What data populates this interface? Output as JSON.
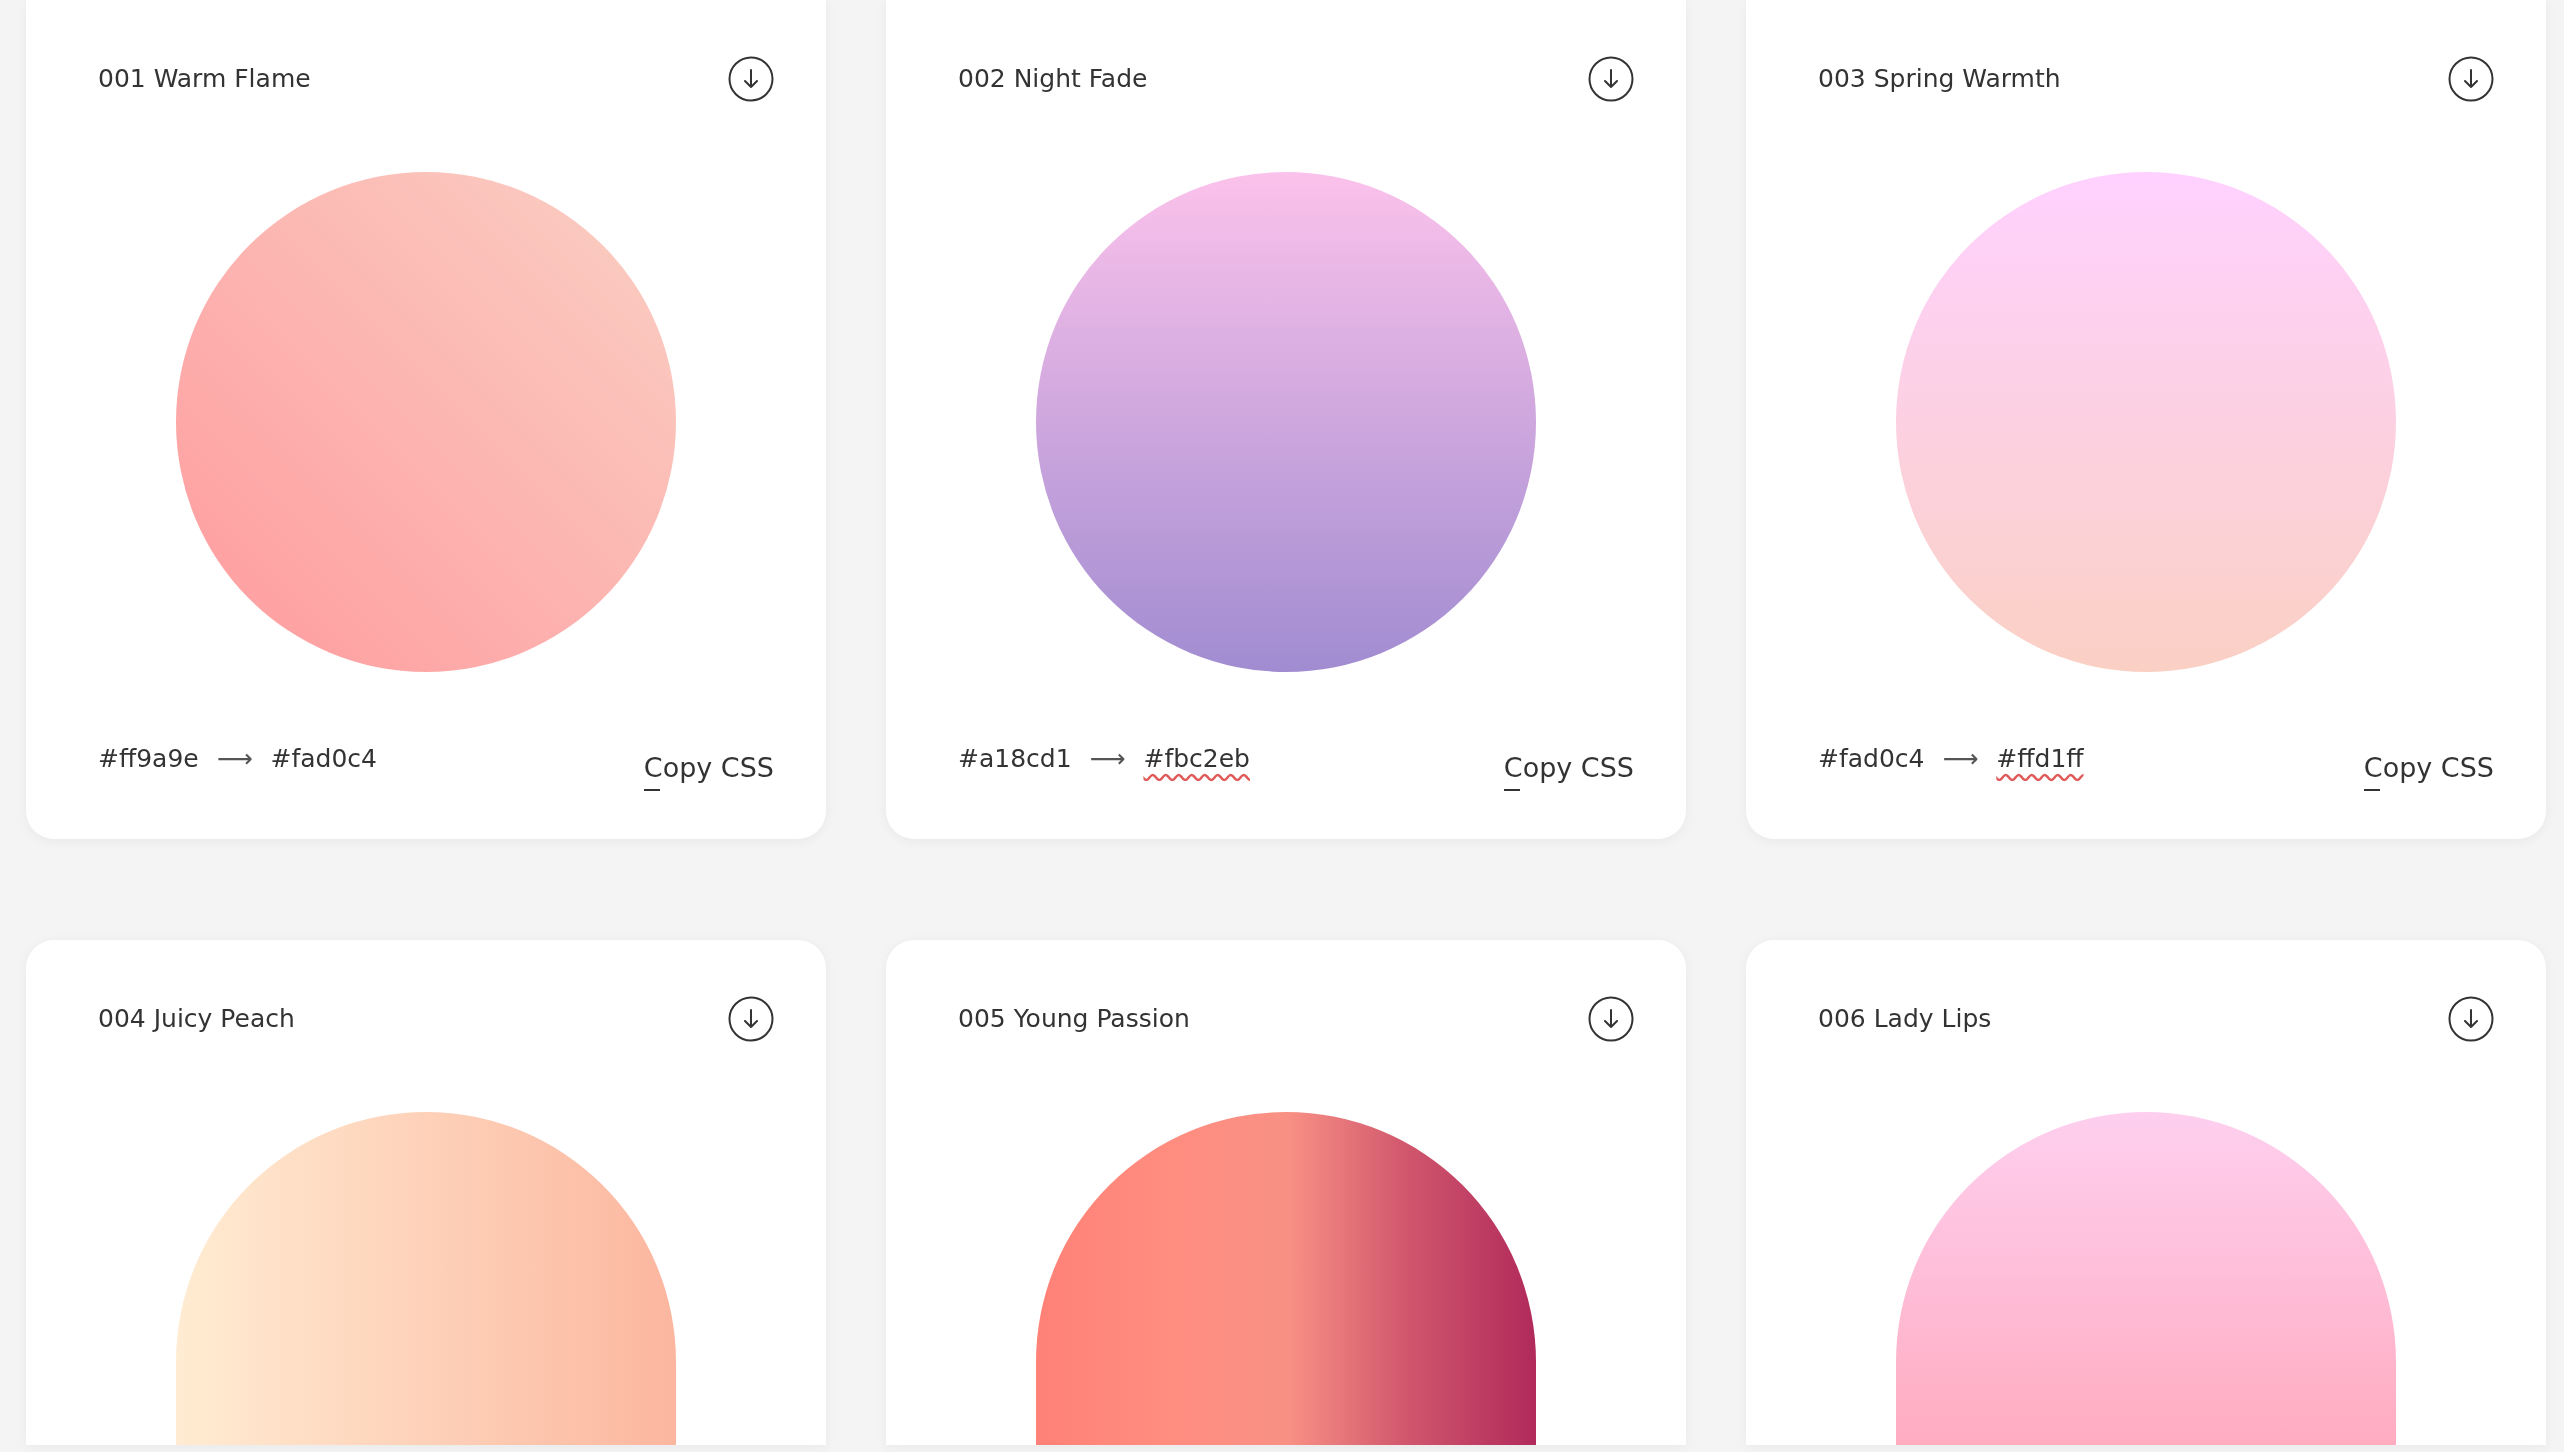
{
  "gradients": [
    {
      "title": "001 Warm Flame",
      "kind": "diagonal",
      "stops": [
        {
          "color": "#ff9a9e"
        },
        {
          "color": "#fad0c4"
        }
      ],
      "footer": {
        "from": "#ff9a9e",
        "arrow": "⟶",
        "to": "#fad0c4",
        "to_flagged": false,
        "copy": "Copy CSS"
      }
    },
    {
      "title": "002 Night Fade",
      "kind": "upward",
      "stops": [
        {
          "color": "#a18cd1"
        },
        {
          "color": "#fbc2eb"
        }
      ],
      "footer": {
        "from": "#a18cd1",
        "arrow": "⟶",
        "to": "#fbc2eb",
        "to_flagged": true,
        "copy": "Copy CSS"
      }
    },
    {
      "title": "003 Spring Warmth",
      "kind": "upward",
      "stops": [
        {
          "color": "#fad0c4"
        },
        {
          "color": "#ffd1ff"
        }
      ],
      "footer": {
        "from": "#fad0c4",
        "arrow": "⟶",
        "to": "#ffd1ff",
        "to_flagged": true,
        "copy": "Copy CSS"
      }
    },
    {
      "title": "004 Juicy Peach",
      "kind": "horizontal",
      "stops": [
        {
          "color": "#ffecd2"
        },
        {
          "color": "#fcb69f"
        }
      ]
    },
    {
      "title": "005 Young Passion",
      "kind": "horizontal",
      "stops": [
        {
          "color": "#ff8177"
        },
        {
          "color": "#ff8c7f"
        },
        {
          "color": "#f99185"
        },
        {
          "color": "#cf556c"
        },
        {
          "color": "#b12a5b"
        }
      ]
    },
    {
      "title": "006 Lady Lips",
      "kind": "upward",
      "stops": [
        {
          "color": "#ffabbf"
        },
        {
          "color": "#fecfef"
        }
      ]
    }
  ]
}
